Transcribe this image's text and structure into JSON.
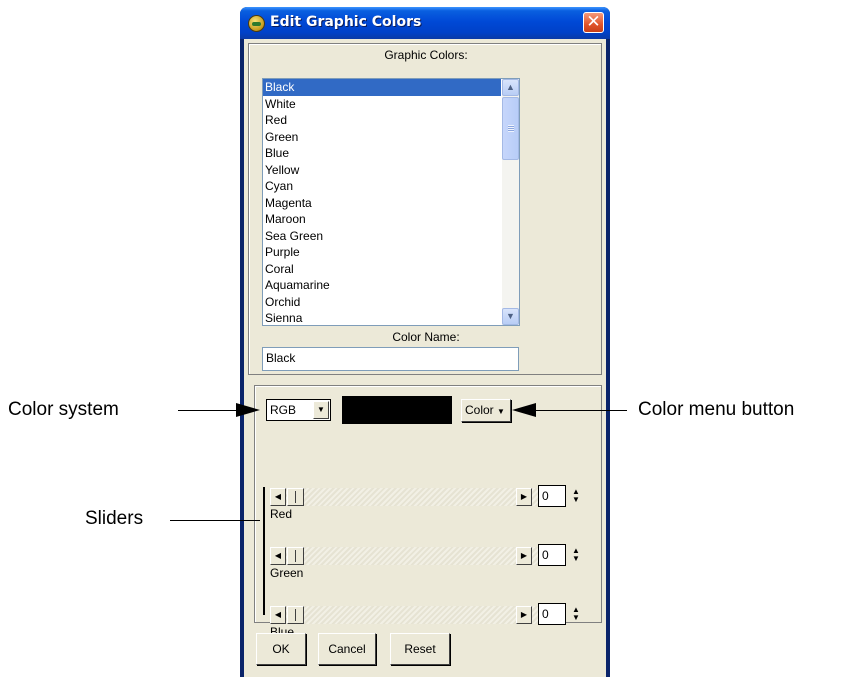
{
  "window": {
    "title": "Edit Graphic Colors",
    "close_glyph": "✕"
  },
  "colors_group": {
    "label": "Graphic Colors:",
    "items": [
      "Black",
      "White",
      "Red",
      "Green",
      "Blue",
      "Yellow",
      "Cyan",
      "Magenta",
      "Maroon",
      "Sea Green",
      "Purple",
      "Coral",
      "Aquamarine",
      "Orchid",
      "Sienna"
    ],
    "selected": "Black"
  },
  "color_name": {
    "label": "Color Name:",
    "value": "Black"
  },
  "editor": {
    "color_system": "RGB",
    "swatch_color": "#000000",
    "color_menu_label": "Color",
    "sliders": [
      {
        "label": "Red",
        "value": "0"
      },
      {
        "label": "Green",
        "value": "0"
      },
      {
        "label": "Blue",
        "value": "0"
      }
    ]
  },
  "buttons": {
    "ok": "OK",
    "cancel": "Cancel",
    "reset": "Reset"
  },
  "callouts": {
    "color_system": "Color system",
    "color_menu_button": "Color menu button",
    "sliders": "Sliders"
  },
  "icons": {
    "app": "globe-icon",
    "close": "close-icon",
    "dropdown": "triangle-down-icon",
    "scroll_up": "chevron-up-icon",
    "scroll_down": "chevron-down-icon",
    "slider_left": "triangle-left-icon",
    "slider_right": "triangle-right-icon",
    "spinner": "up-down-icon"
  },
  "theme": {
    "titlebar": "#0049d6",
    "selection": "#316ac5",
    "face": "#ece9d8"
  }
}
